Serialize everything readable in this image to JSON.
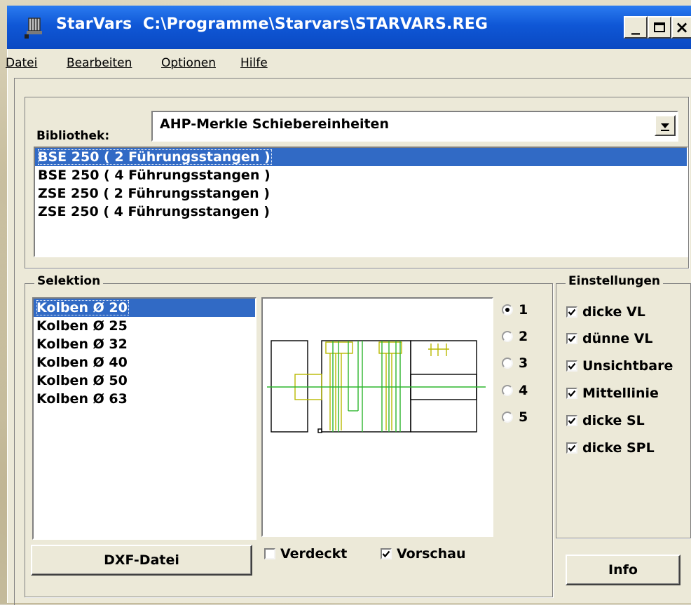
{
  "window": {
    "app_name": "StarVars",
    "file_path": "C:\\Programme\\Starvars\\STARVARS.REG",
    "minimize_label": "_",
    "maximize_label": "□",
    "close_label": "×"
  },
  "menu": {
    "items": [
      {
        "label": "Datei"
      },
      {
        "label": "Bearbeiten"
      },
      {
        "label": "Optionen"
      },
      {
        "label": "Hilfe"
      }
    ]
  },
  "library": {
    "label": "Bibliothek:",
    "selected": "AHP-Merkle Schiebereinheiten",
    "items": [
      {
        "label": "BSE 250 ( 2 Führungsstangen )",
        "selected": true
      },
      {
        "label": "BSE 250 ( 4 Führungsstangen )",
        "selected": false
      },
      {
        "label": "ZSE 250 ( 2 Führungsstangen )",
        "selected": false
      },
      {
        "label": "ZSE 250 ( 4 Führungsstangen )",
        "selected": false
      }
    ]
  },
  "selection": {
    "group_label": "Selektion",
    "items": [
      {
        "label": "Kolben Ø 20",
        "selected": true
      },
      {
        "label": "Kolben Ø 25",
        "selected": false
      },
      {
        "label": "Kolben Ø 32",
        "selected": false
      },
      {
        "label": "Kolben Ø 40",
        "selected": false
      },
      {
        "label": "Kolben Ø 50",
        "selected": false
      },
      {
        "label": "Kolben Ø 63",
        "selected": false
      }
    ],
    "radios": [
      {
        "label": "1",
        "checked": true
      },
      {
        "label": "2",
        "checked": false
      },
      {
        "label": "3",
        "checked": false
      },
      {
        "label": "4",
        "checked": false
      },
      {
        "label": "5",
        "checked": false
      }
    ],
    "dxf_button": "DXF-Datei",
    "hidden_checkbox": {
      "label": "Verdeckt",
      "checked": false
    },
    "preview_checkbox": {
      "label": "Vorschau",
      "checked": true
    }
  },
  "settings": {
    "group_label": "Einstellungen",
    "options": [
      {
        "label": "dicke VL",
        "checked": true
      },
      {
        "label": "dünne VL",
        "checked": true
      },
      {
        "label": "Unsichtbare",
        "checked": true
      },
      {
        "label": "Mittellinie",
        "checked": true
      },
      {
        "label": "dicke SL",
        "checked": true
      },
      {
        "label": "dicke SPL",
        "checked": true
      }
    ],
    "info_button": "Info"
  },
  "colors": {
    "titlebar": "#0f57d6",
    "selection": "#316ac5",
    "drawing_yellow": "#b8b800",
    "drawing_green": "#2db52d"
  }
}
